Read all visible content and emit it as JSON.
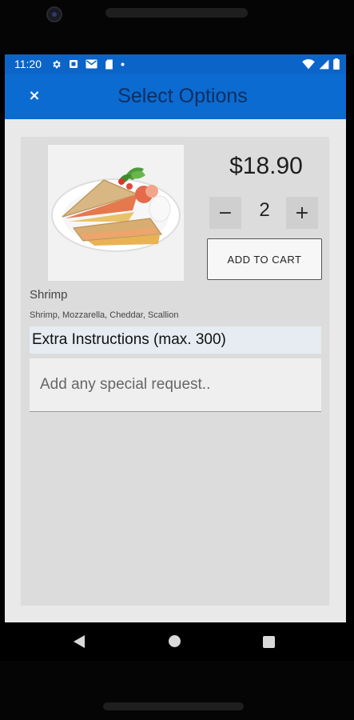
{
  "status_bar": {
    "time": "11:20",
    "left_icons": [
      "settings-icon",
      "notification-square-icon",
      "gmail-icon",
      "sd-card-icon",
      "dot-icon"
    ],
    "right_icons": [
      "wifi-icon",
      "cell-signal-icon",
      "battery-icon"
    ],
    "color": "#0b64c8"
  },
  "app_bar": {
    "close_label": "×",
    "title": "Select Options",
    "color": "#0b6bd0"
  },
  "product": {
    "price": "$18.90",
    "quantity": "2",
    "minus_label": "−",
    "plus_label": "+",
    "add_to_cart_label": "ADD TO CART",
    "name": "Shrimp",
    "description": "Shrimp, Mozzarella, Cheddar, Scallion"
  },
  "instructions": {
    "label": "Extra Instructions (max. 300)",
    "placeholder": "Add any special request.."
  },
  "navigation": {
    "buttons": [
      "back-icon",
      "home-icon",
      "recents-icon"
    ]
  }
}
